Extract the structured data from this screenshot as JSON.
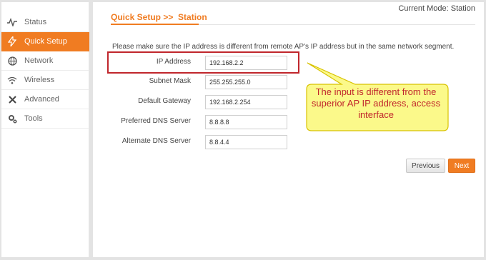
{
  "header": {
    "mode": "Current Mode: Station"
  },
  "sidebar": {
    "items": [
      {
        "label": "Status",
        "icon": "pulse-icon",
        "active": false
      },
      {
        "label": "Quick Setup",
        "icon": "lightning-icon",
        "active": true
      },
      {
        "label": "Network",
        "icon": "globe-icon",
        "active": false
      },
      {
        "label": "Wireless",
        "icon": "wifi-icon",
        "active": false
      },
      {
        "label": "Advanced",
        "icon": "tools-icon",
        "active": false
      },
      {
        "label": "Tools",
        "icon": "gear-icon",
        "active": false
      }
    ]
  },
  "page": {
    "title": "Quick Setup >>  Station",
    "notice": "Please make sure the IP address is different from remote AP's IP address but in the same network segment."
  },
  "form": {
    "fields": [
      {
        "label": "IP Address",
        "value": "192.168.2.2"
      },
      {
        "label": "Subnet Mask",
        "value": "255.255.255.0"
      },
      {
        "label": "Default Gateway",
        "value": "192.168.2.254"
      },
      {
        "label": "Preferred DNS Server",
        "value": "8.8.8.8"
      },
      {
        "label": "Alternate DNS Server",
        "value": "8.8.4.4"
      }
    ]
  },
  "buttons": {
    "previous": "Previous",
    "next": "Next"
  },
  "annotation": {
    "text": "The input is different from the superior AP IP address, access interface"
  },
  "colors": {
    "accent": "#f07c22",
    "highlight": "#c0262c",
    "callout_fill": "#fbf98a"
  }
}
